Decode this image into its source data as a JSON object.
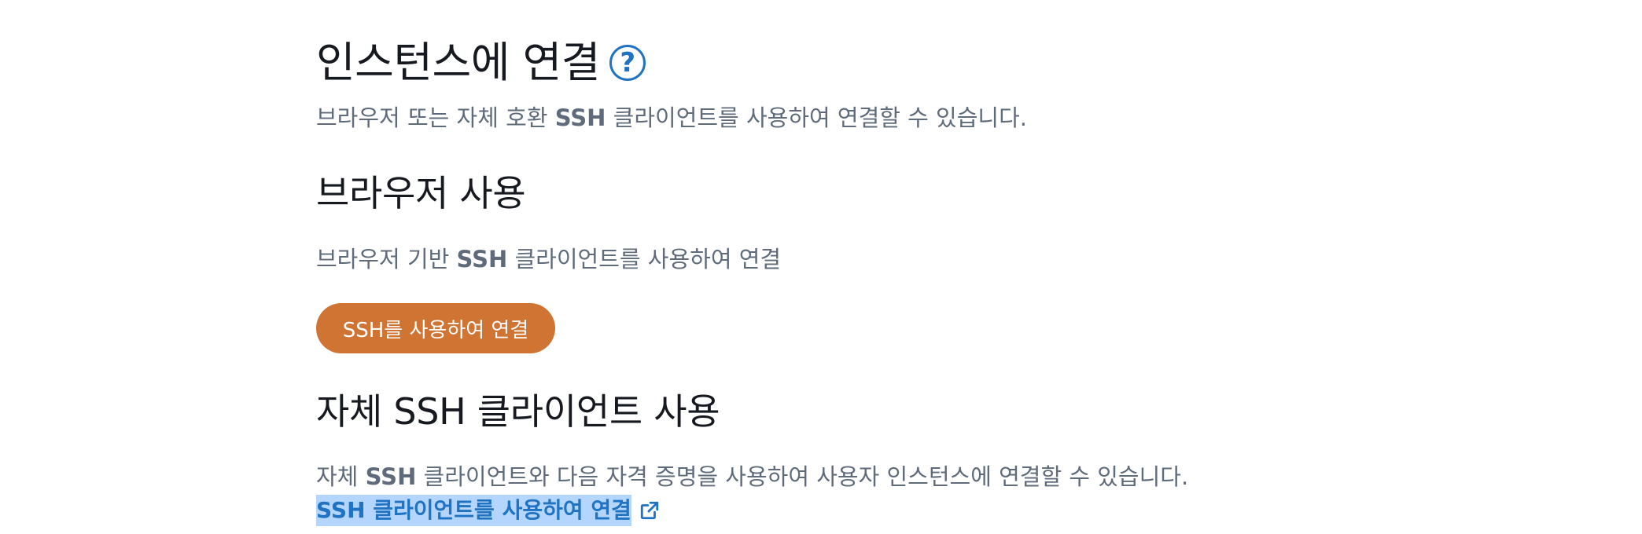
{
  "header": {
    "title": "인스턴스에 연결",
    "help_icon_glyph": "?",
    "description_prefix": "브라우저 또는 자체 호환 ",
    "description_bold": "SSH",
    "description_suffix": " 클라이언트를 사용하여 연결할 수 있습니다."
  },
  "browser_section": {
    "title": "브라우저 사용",
    "description_prefix": "브라우저 기반 ",
    "description_bold": "SSH",
    "description_suffix": " 클라이언트를 사용하여 연결",
    "button_label": "SSH를 사용하여 연결"
  },
  "own_client_section": {
    "title": "자체 SSH 클라이언트 사용",
    "description_prefix": "자체 ",
    "description_bold": "SSH",
    "description_suffix": " 클라이언트와 다음 자격 증명을 사용하여 사용자 인스턴스에 연결할 수 있습니다.",
    "link_label": "SSH 클라이언트를 사용하여 연결",
    "link_icon": "external-link-icon"
  },
  "colors": {
    "accent_button": "#d07434",
    "link": "#1f73c2",
    "selection_highlight": "#b4d5fe"
  }
}
